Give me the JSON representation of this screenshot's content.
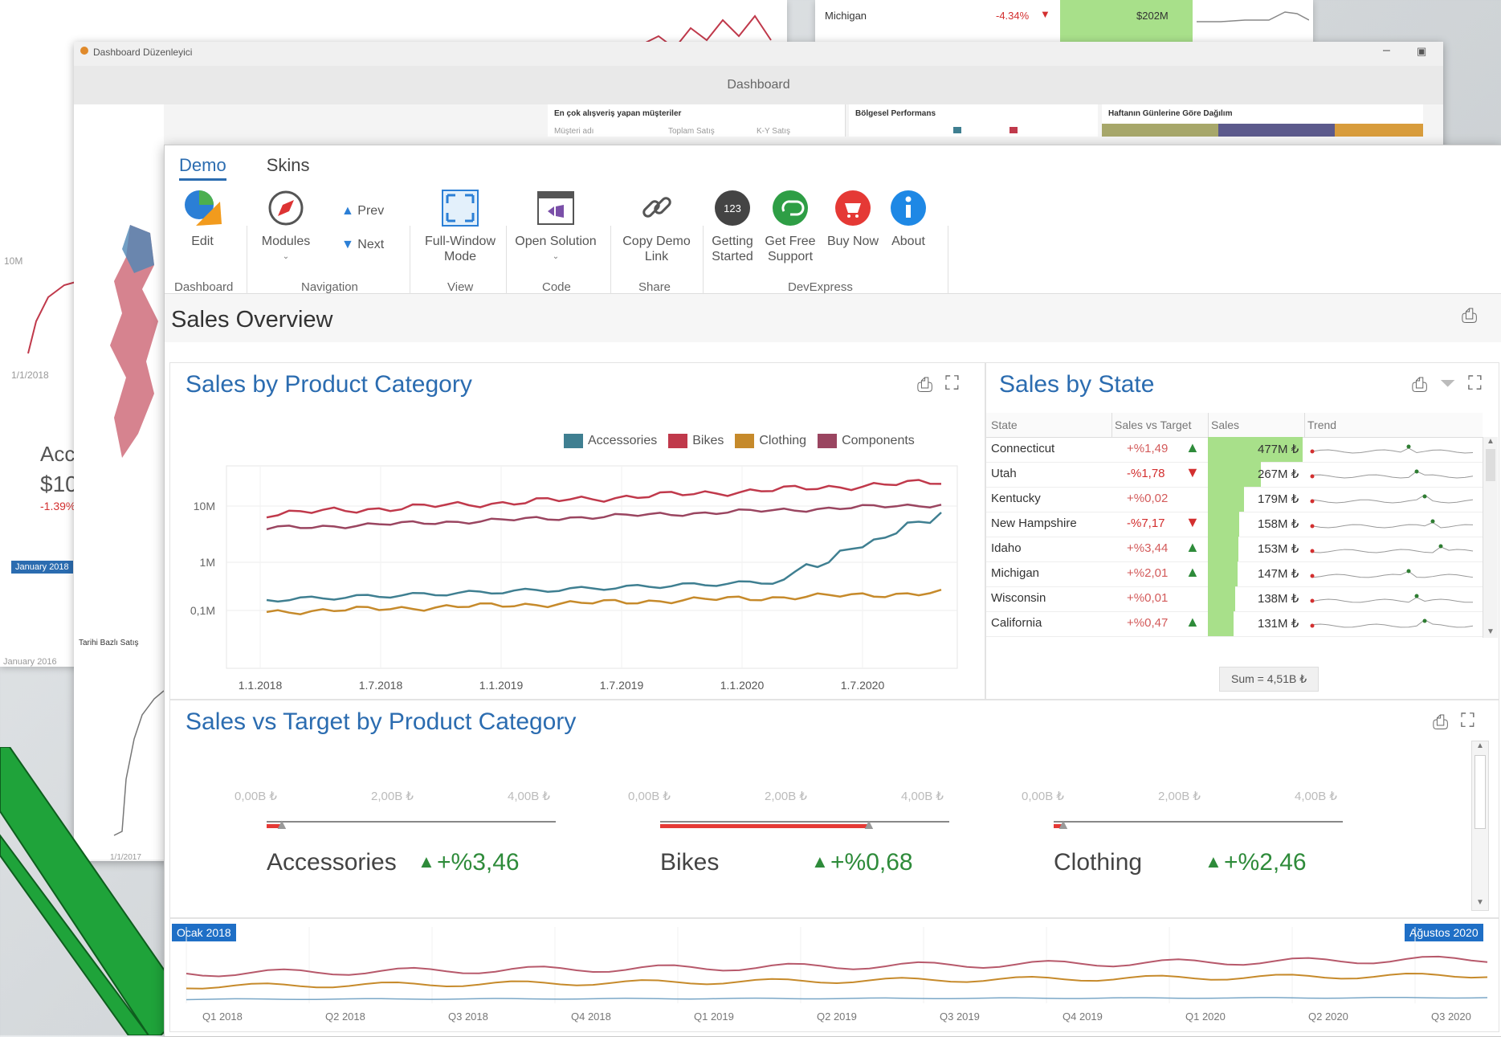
{
  "bg": {
    "top_state": "Michigan",
    "top_pct": "-4.34%",
    "top_sales": "$202M",
    "left_axis_10m": "10M",
    "left_date": "1/1/2018",
    "left_card_title": "Acc",
    "left_card_value": "$10",
    "left_card_delta": "-1.39%",
    "left_month": "January 2018",
    "left_month2": "January 2016"
  },
  "mid": {
    "window_title": "Dashboard Düzenleyici",
    "header": "Dashboard",
    "panel1": "En çok alışveriş yapan müşteriler",
    "panel2": "Bölgesel Performans",
    "panel3": "Haftanın Günlerine Göre Dağılım",
    "col1": "Müşteri adı",
    "col2": "Toplam Satış",
    "col3": "K-Y Satış",
    "side_title": "Tarihi Bazlı Satış",
    "side_date": "1/1/2017"
  },
  "ribbon": {
    "tabs": [
      "Demo",
      "Skins"
    ],
    "edit": "Edit",
    "modules": "Modules",
    "prev": "Prev",
    "next": "Next",
    "fullwindow": "Full-Window Mode",
    "opensolution": "Open Solution",
    "copydemo": "Copy Demo Link",
    "gettingstarted": "Getting Started",
    "freesupport": "Get Free Support",
    "buynow": "Buy Now",
    "about": "About",
    "groups": {
      "dashboard": "Dashboard",
      "navigation": "Navigation",
      "view": "View",
      "code": "Code",
      "share": "Share",
      "devexpress": "DevExpress"
    },
    "badge_123": "123"
  },
  "dashboard": {
    "title": "Sales Overview"
  },
  "category_chart": {
    "title": "Sales by Product Category",
    "legend": [
      {
        "name": "Accessories",
        "color": "#3f7f91"
      },
      {
        "name": "Bikes",
        "color": "#c0394b"
      },
      {
        "name": "Clothing",
        "color": "#c68a2b"
      },
      {
        "name": "Components",
        "color": "#9a4560"
      }
    ],
    "y_ticks": [
      "10M",
      "1M",
      "0,1M"
    ],
    "x_ticks": [
      "1.1.2018",
      "1.7.2018",
      "1.1.2019",
      "1.7.2019",
      "1.1.2020",
      "1.7.2020"
    ]
  },
  "state_grid": {
    "title": "Sales by State",
    "headers": [
      "State",
      "Sales vs Target",
      "Sales",
      "Trend"
    ],
    "rows": [
      {
        "state": "Connecticut",
        "delta": "+%1,49",
        "dir": "up",
        "sales": "477M ₺",
        "bar": 1.0
      },
      {
        "state": "Utah",
        "delta": "-%1,78",
        "dir": "down",
        "sales": "267M ₺",
        "bar": 0.56
      },
      {
        "state": "Kentucky",
        "delta": "+%0,02",
        "dir": "none",
        "sales": "179M ₺",
        "bar": 0.38
      },
      {
        "state": "New Hampshire",
        "delta": "-%7,17",
        "dir": "down",
        "sales": "158M ₺",
        "bar": 0.33
      },
      {
        "state": "Idaho",
        "delta": "+%3,44",
        "dir": "up",
        "sales": "153M ₺",
        "bar": 0.32
      },
      {
        "state": "Michigan",
        "delta": "+%2,01",
        "dir": "up",
        "sales": "147M ₺",
        "bar": 0.31
      },
      {
        "state": "Wisconsin",
        "delta": "+%0,01",
        "dir": "none",
        "sales": "138M ₺",
        "bar": 0.29
      },
      {
        "state": "California",
        "delta": "+%0,47",
        "dir": "up",
        "sales": "131M ₺",
        "bar": 0.27
      }
    ],
    "sum": "Sum = 4,51B ₺"
  },
  "target": {
    "title": "Sales vs Target by Product Category",
    "scale": [
      "0,00B ₺",
      "2,00B ₺",
      "4,00B ₺"
    ],
    "gauges": [
      {
        "name": "Accessories",
        "delta": "+%3,46",
        "fill": 0.05
      },
      {
        "name": "Bikes",
        "delta": "+%0,68",
        "fill": 0.72
      },
      {
        "name": "Clothing",
        "delta": "+%2,46",
        "fill": 0.03
      }
    ]
  },
  "range": {
    "start": "Ocak 2018",
    "end": "Ağustos 2020",
    "quarters": [
      "Q1 2018",
      "Q2 2018",
      "Q3 2018",
      "Q4 2018",
      "Q1 2019",
      "Q2 2019",
      "Q3 2019",
      "Q4 2019",
      "Q1 2020",
      "Q2 2020",
      "Q3 2020"
    ]
  },
  "colors": {
    "accent": "#2b6cb0",
    "up": "#2e8b3a",
    "down": "#d32f2f",
    "bar": "#a8e08a",
    "green_stripe": "#1fa33a"
  }
}
